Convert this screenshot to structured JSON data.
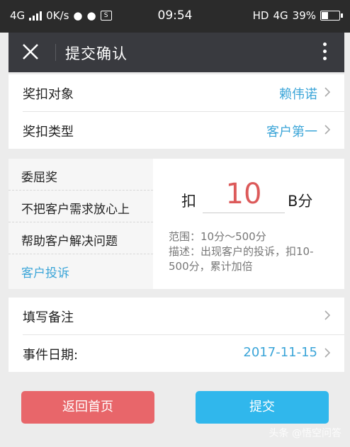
{
  "status_bar": {
    "network": "4G",
    "speed": "0K/s",
    "time": "09:54",
    "hd": "HD",
    "network_right": "4G",
    "battery": "39%",
    "battery_level": 0.39
  },
  "app_bar": {
    "title": "提交确认"
  },
  "rows_top": [
    {
      "label": "奖扣对象",
      "value": "赖伟诺"
    },
    {
      "label": "奖扣类型",
      "value": "客户第一"
    }
  ],
  "types": [
    "委屈奖",
    "不把客户需求放心上",
    "帮助客户解决问题",
    "客户投诉"
  ],
  "active_type_index": 3,
  "amount": {
    "prefix": "扣",
    "value": "10",
    "suffix": "B分",
    "range": "范围：10分～500分",
    "description": "描述：出现客户的投诉，扣10-500分，累计加倍"
  },
  "rows_bottom": [
    {
      "label": "填写备注",
      "value": ""
    },
    {
      "label": "事件日期:",
      "value": "2017-11-15"
    }
  ],
  "buttons": {
    "home": "返回首页",
    "submit": "提交"
  },
  "watermark": "头条 @悟空问答",
  "colors": {
    "accent": "#3ba5d8",
    "danger": "#e8666a",
    "primary": "#30b7ec",
    "amount": "#dc5a5a"
  }
}
